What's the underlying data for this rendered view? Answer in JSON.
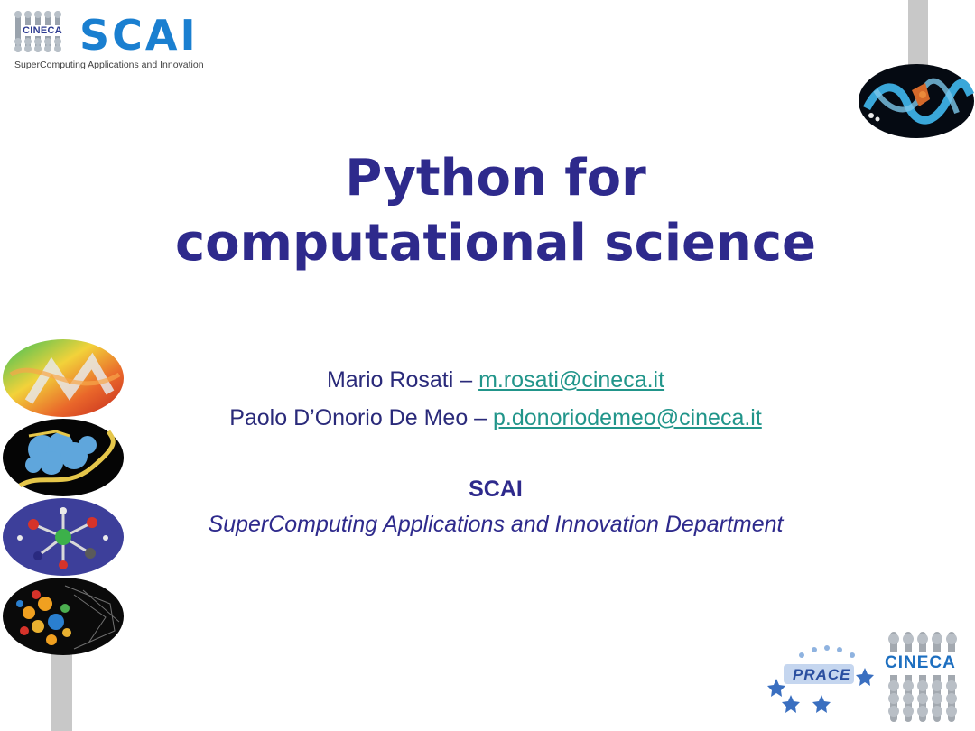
{
  "header": {
    "logo_small": "CINECA",
    "logo_main": "SCAI",
    "logo_tagline": "SuperComputing Applications and Innovation"
  },
  "title": {
    "line1": "Python for",
    "line2": "computational science"
  },
  "authors": [
    {
      "name": "Mario Rosati – ",
      "email": "m.rosati@cineca.it"
    },
    {
      "name": "Paolo D’Onorio De Meo – ",
      "email": "p.donoriodemeo@cineca.it"
    }
  ],
  "organization": {
    "name": "SCAI",
    "department": "SuperComputing Applications and Innovation Department"
  },
  "footer": {
    "prace_logo": "PRACE",
    "cineca_logo": "CINECA"
  },
  "colors": {
    "title": "#2e2a8c",
    "link": "#21958a",
    "scai_blue": "#1a7fd0"
  },
  "icons": {
    "top_right": "protein-ribbon-image",
    "left_column": [
      "fluid-dynamics-image",
      "molecule-surface-image",
      "molecular-structure-image",
      "crystal-lattice-image"
    ]
  }
}
